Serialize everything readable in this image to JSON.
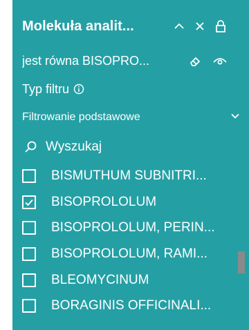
{
  "header": {
    "title": "Molekuła analit...",
    "icons": [
      "chevron-up-icon",
      "close-icon",
      "lock-icon"
    ]
  },
  "filter_summary": {
    "text": "jest równa BISOPRO...",
    "icons": [
      "eraser-icon",
      "eye-icon"
    ]
  },
  "filter_type": {
    "label": "Typ filtru",
    "icon": "info-icon"
  },
  "dropdown": {
    "selected": "Filtrowanie podstawowe",
    "icon": "chevron-down-icon"
  },
  "search": {
    "placeholder": "Wyszukaj",
    "icon": "search-icon"
  },
  "items": [
    {
      "label": "BISMUTHUM SUBNITRI...",
      "checked": false
    },
    {
      "label": "BISOPROLOLUM",
      "checked": true
    },
    {
      "label": "BISOPROLOLUM, PERIN...",
      "checked": false
    },
    {
      "label": "BISOPROLOLUM, RAMI...",
      "checked": false
    },
    {
      "label": "BLEOMYCINUM",
      "checked": false
    },
    {
      "label": "BORAGINIS OFFICINALI...",
      "checked": false
    }
  ],
  "colors": {
    "panel_background": "#24a0a5",
    "text": "#ffffff",
    "scrollbar": "#8a8a8a"
  }
}
